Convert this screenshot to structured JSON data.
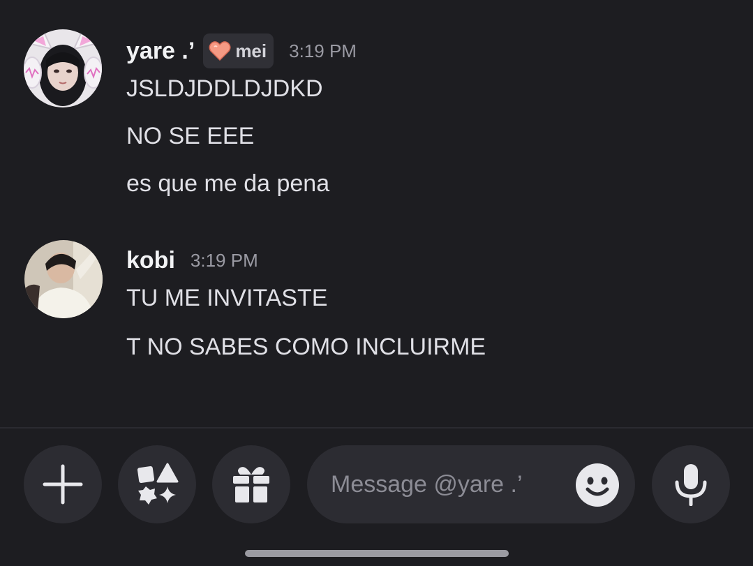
{
  "messages": [
    {
      "username": "yare .’",
      "tag": "mei",
      "time": "3:19 PM",
      "lines": [
        "JSLDJDDLDJDKD",
        "NO SE EEE",
        "es que me da pena"
      ]
    },
    {
      "username": "kobi",
      "time": "3:19 PM",
      "lines": [
        "TU ME INVITASTE",
        "T NO SABES COMO INCLUIRME"
      ]
    }
  ],
  "composer": {
    "placeholder": "Message @yare .’",
    "icons": [
      "plus-icon",
      "apps-icon",
      "gift-icon",
      "emoji-icon",
      "microphone-icon"
    ]
  },
  "colors": {
    "background": "#1d1d21",
    "button": "#2c2c32",
    "timestamp": "#9a9aa3"
  }
}
